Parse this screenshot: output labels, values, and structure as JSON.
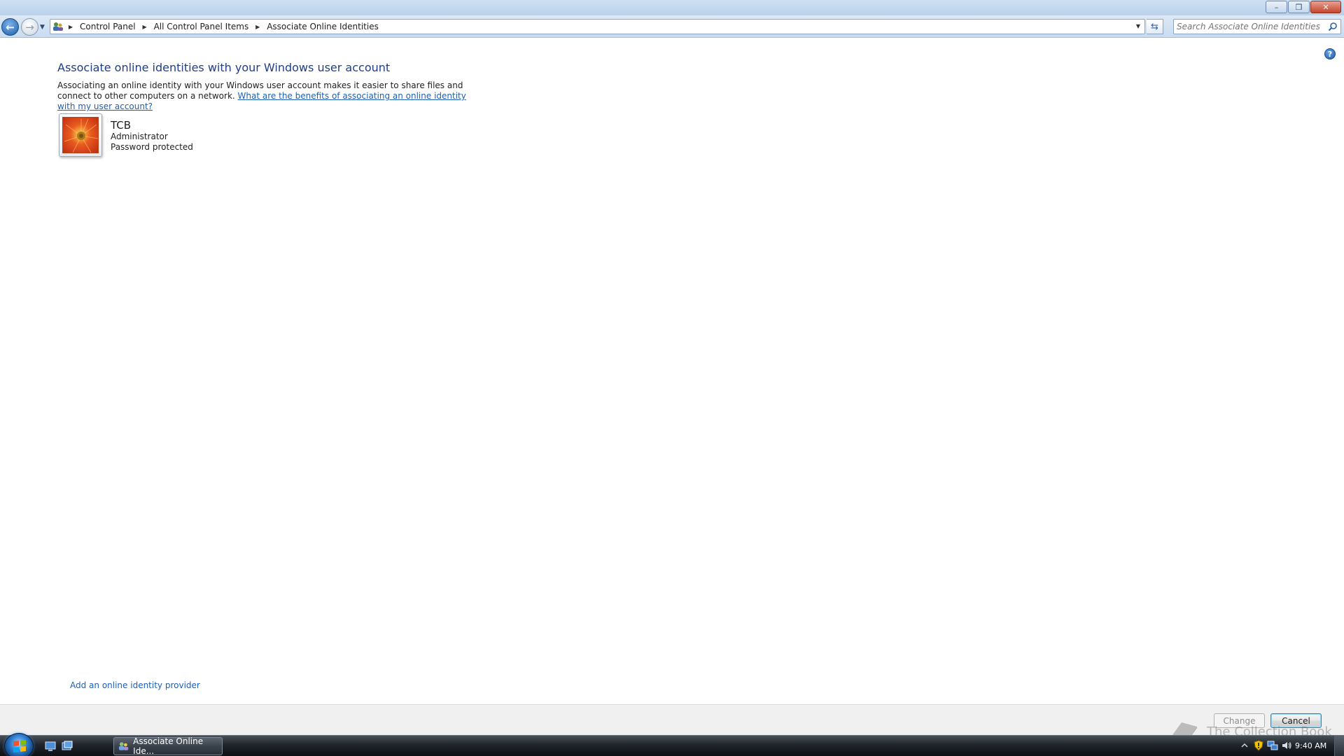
{
  "window": {
    "caption_buttons": {
      "minimize": "–",
      "restore": "❐",
      "close": "✕"
    }
  },
  "navigation": {
    "breadcrumb": [
      "Control Panel",
      "All Control Panel Items",
      "Associate Online Identities"
    ],
    "search_placeholder": "Search Associate Online Identities ..."
  },
  "content": {
    "help": "?",
    "title": "Associate online identities with your Windows user account",
    "description": "Associating an online identity with your Windows user account makes it easier to share files and connect to other computers on a network.",
    "benefits_link": "What are the benefits of associating an online identity with my user account?",
    "account": {
      "name": "TCB",
      "role": "Administrator",
      "status": "Password protected"
    },
    "add_provider_link": "Add an online identity provider"
  },
  "footer": {
    "change_label": "Change",
    "cancel_label": "Cancel",
    "watermark": "The Collection Book"
  },
  "taskbar": {
    "task_label": "Associate Online Ide...",
    "clock": "9:40 AM"
  }
}
